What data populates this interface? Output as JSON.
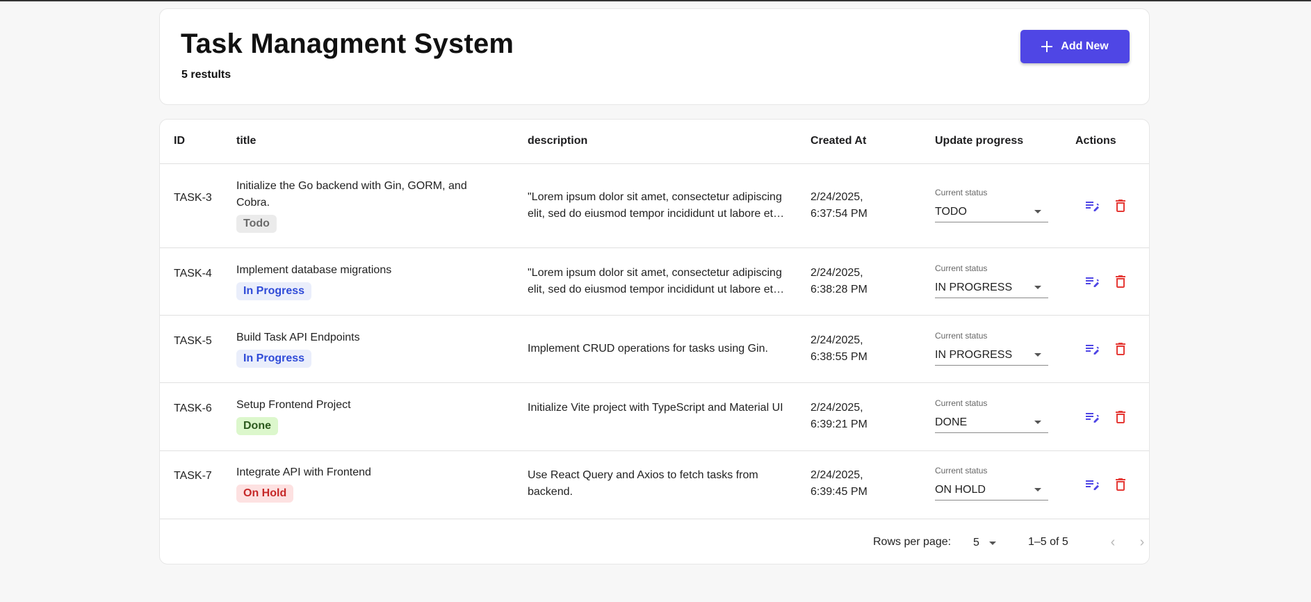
{
  "header": {
    "title": "Task Managment System",
    "result_count": "5 restults",
    "add_button_label": "Add New"
  },
  "table": {
    "columns": [
      "ID",
      "title",
      "description",
      "Created At",
      "Update progress",
      "Actions"
    ],
    "status_field_label": "Current status",
    "rows": [
      {
        "id": "TASK-3",
        "title": "Initialize the Go backend with Gin, GORM, and Cobra.",
        "chip": "Todo",
        "description": "\"Lorem ipsum dolor sit amet, consectetur adipiscing elit, sed do eiusmod tempor incididunt ut labore et dolore magna aliqua.",
        "created_at": "2/24/2025, 6:37:54 PM",
        "status": "TODO"
      },
      {
        "id": "TASK-4",
        "title": "Implement database migrations",
        "chip": "In Progress",
        "description": "\"Lorem ipsum dolor sit amet, consectetur adipiscing elit, sed do eiusmod tempor incididunt ut labore et dolore magna aliqua.",
        "created_at": "2/24/2025, 6:38:28 PM",
        "status": "IN PROGRESS"
      },
      {
        "id": "TASK-5",
        "title": "Build Task API Endpoints",
        "chip": "In Progress",
        "description": "Implement CRUD operations for tasks using Gin.",
        "created_at": "2/24/2025, 6:38:55 PM",
        "status": "IN PROGRESS"
      },
      {
        "id": "TASK-6",
        "title": "Setup Frontend Project",
        "chip": "Done",
        "description": "Initialize Vite project with TypeScript and Material UI",
        "created_at": "2/24/2025, 6:39:21 PM",
        "status": "DONE"
      },
      {
        "id": "TASK-7",
        "title": "Integrate API with Frontend",
        "chip": "On Hold",
        "description": "Use React Query and Axios to fetch tasks from backend.",
        "created_at": "2/24/2025, 6:39:45 PM",
        "status": "ON HOLD"
      }
    ]
  },
  "pagination": {
    "rows_per_page_label": "Rows per page:",
    "rows_per_page": "5",
    "range": "1–5 of 5"
  },
  "colors": {
    "accent": "#4f46e5",
    "delete": "#e53935",
    "chip_todo": "#ebebeb",
    "chip_in_progress": "#eaeefb",
    "chip_done": "#dcf7cc",
    "chip_on_hold": "#fde1e1"
  },
  "icons": {
    "add": "plus-icon",
    "edit": "edit-note-icon",
    "delete": "trash-icon",
    "dropdown": "caret-down-icon",
    "prev": "chevron-left-icon",
    "next": "chevron-right-icon"
  }
}
